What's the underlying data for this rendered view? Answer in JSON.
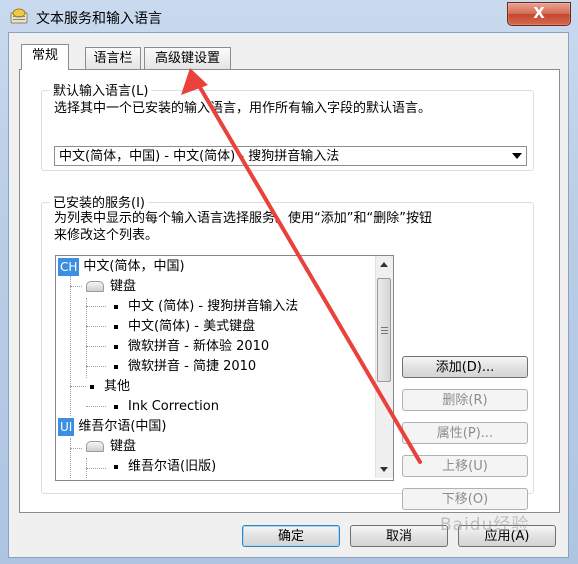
{
  "window": {
    "title": "文本服务和输入语言",
    "close_label": "X"
  },
  "tabs": [
    {
      "label": "常规",
      "active": true
    },
    {
      "label": "语言栏",
      "active": false
    },
    {
      "label": "高级键设置",
      "active": false
    }
  ],
  "default_language": {
    "group_label": "默认输入语言(L)",
    "description": "选择其中一个已安装的输入语言，用作所有输入字段的默认语言。",
    "selected": "中文(简体，中国) - 中文(简体) - 搜狗拼音输入法"
  },
  "installed_services": {
    "group_label": "已安装的服务(I)",
    "description_line1": "为列表中显示的每个输入语言选择服务。使用“添加”和“删除”按钮",
    "description_line2": "来修改这个列表。",
    "tree": {
      "lang1_badge": "CH",
      "lang1": "中文(简体，中国)",
      "lang1_keyboard": "键盘",
      "lang1_items": [
        "中文 (简体) - 搜狗拼音输入法",
        "中文(简体) - 美式键盘",
        "微软拼音 - 新体验 2010",
        "微软拼音 - 简捷 2010"
      ],
      "lang1_other": "其他",
      "lang1_other_items": [
        "Ink Correction"
      ],
      "lang2_badge": "UI",
      "lang2": "维吾尔语(中国)",
      "lang2_keyboard": "键盘",
      "lang2_items": [
        "维吾尔语(旧版)"
      ]
    },
    "buttons": {
      "add": "添加(D)...",
      "remove": "删除(R)",
      "properties": "属性(P)...",
      "move_up": "上移(U)",
      "move_down": "下移(O)"
    }
  },
  "footer": {
    "ok": "确定",
    "cancel": "取消",
    "apply": "应用(A)"
  },
  "watermark": "Baidu经验",
  "colors": {
    "annotation_arrow": "#e8423b",
    "language_badge": "#3c8ee0"
  }
}
